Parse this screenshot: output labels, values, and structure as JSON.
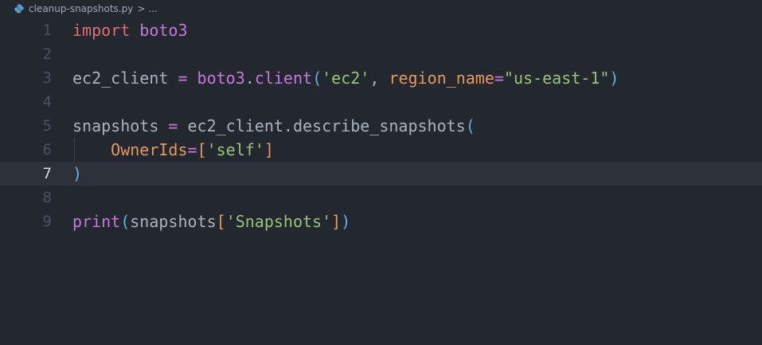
{
  "breadcrumb": {
    "file": "cleanup-snapshots.py",
    "separator": ">",
    "more": "..."
  },
  "icons": {
    "file_icon": "python-icon"
  },
  "colors": {
    "background": "#23272e",
    "current_line": "#2c313a",
    "line_number": "#495162",
    "keyword": "#e06c75",
    "module": "#c678dd",
    "string": "#98c379",
    "param": "#e5995e",
    "bracket": "#61afef"
  },
  "editor": {
    "current_line": 7,
    "lines": [
      {
        "n": "1",
        "tokens": [
          {
            "t": "import",
            "c": "kw"
          },
          {
            "t": " ",
            "c": "plain"
          },
          {
            "t": "boto3",
            "c": "mod"
          }
        ]
      },
      {
        "n": "2",
        "tokens": []
      },
      {
        "n": "3",
        "tokens": [
          {
            "t": "ec2_client",
            "c": "plain"
          },
          {
            "t": " = ",
            "c": "op"
          },
          {
            "t": "boto3",
            "c": "mod"
          },
          {
            "t": ".",
            "c": "plain"
          },
          {
            "t": "client",
            "c": "fn"
          },
          {
            "t": "(",
            "c": "br"
          },
          {
            "t": "'ec2'",
            "c": "str"
          },
          {
            "t": ", ",
            "c": "plain"
          },
          {
            "t": "region_name",
            "c": "param"
          },
          {
            "t": "=",
            "c": "op"
          },
          {
            "t": "\"us-east-1\"",
            "c": "str"
          },
          {
            "t": ")",
            "c": "br"
          }
        ]
      },
      {
        "n": "4",
        "tokens": []
      },
      {
        "n": "5",
        "tokens": [
          {
            "t": "snapshots",
            "c": "plain"
          },
          {
            "t": " = ",
            "c": "op"
          },
          {
            "t": "ec2_client",
            "c": "plain"
          },
          {
            "t": ".",
            "c": "plain"
          },
          {
            "t": "describe_snapshots",
            "c": "plain"
          },
          {
            "t": "(",
            "c": "br"
          }
        ]
      },
      {
        "n": "6",
        "tokens": [
          {
            "t": "    ",
            "c": "plain"
          },
          {
            "t": "OwnerIds",
            "c": "param"
          },
          {
            "t": "=",
            "c": "op"
          },
          {
            "t": "[",
            "c": "param"
          },
          {
            "t": "'self'",
            "c": "str"
          },
          {
            "t": "]",
            "c": "param"
          }
        ]
      },
      {
        "n": "7",
        "tokens": [
          {
            "t": ")",
            "c": "br"
          }
        ]
      },
      {
        "n": "8",
        "tokens": []
      },
      {
        "n": "9",
        "tokens": [
          {
            "t": "print",
            "c": "fn"
          },
          {
            "t": "(",
            "c": "br"
          },
          {
            "t": "snapshots",
            "c": "plain"
          },
          {
            "t": "[",
            "c": "param"
          },
          {
            "t": "'Snapshots'",
            "c": "str"
          },
          {
            "t": "]",
            "c": "param"
          },
          {
            "t": ")",
            "c": "br"
          }
        ]
      }
    ]
  }
}
